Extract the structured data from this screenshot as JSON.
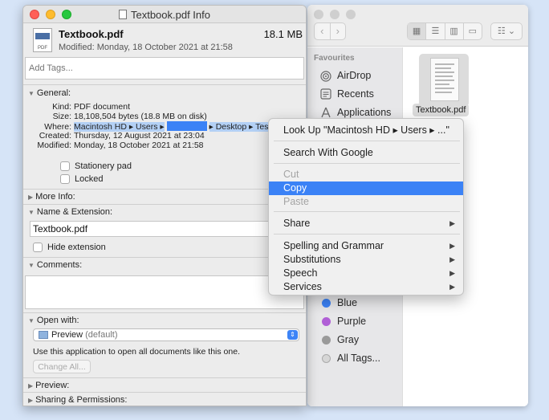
{
  "finder": {
    "nav_back": "‹",
    "nav_forward": "›",
    "view_modes": [
      "▦",
      "☰",
      "▥",
      "▭"
    ],
    "group_label": "☷ ⌄",
    "sidebar_header": "Favourites",
    "sidebar_items": [
      {
        "label": "AirDrop",
        "icon": "airdrop-icon"
      },
      {
        "label": "Recents",
        "icon": "clock-icon"
      },
      {
        "label": "Applications",
        "icon": "applications-icon"
      }
    ],
    "tags": [
      {
        "label": "Blue",
        "color": "#3b82f6"
      },
      {
        "label": "Purple",
        "color": "#b05fd6"
      },
      {
        "label": "Gray",
        "color": "#9a9a9a"
      },
      {
        "label": "All Tags...",
        "color": "#d6d6d6"
      }
    ],
    "file_label": "Textbook.pdf"
  },
  "info": {
    "window_title": "Textbook.pdf Info",
    "icon_label": "PDF",
    "file_name": "Textbook.pdf",
    "file_size": "18.1 MB",
    "modified_line": "Modified: Monday, 18 October 2021 at 21:58",
    "tags_placeholder": "Add Tags...",
    "general": {
      "header": "General:",
      "kind_label": "Kind:",
      "kind": "PDF document",
      "size_label": "Size:",
      "size": "18,108,504 bytes (18.8 MB on disk)",
      "where_label": "Where:",
      "where_start": "Macintosh HD ▸ Users ▸",
      "where_end": "▸ Desktop ▸ Test",
      "created_label": "Created:",
      "created": "Thursday, 12 August 2021 at 23:04",
      "modified_label": "Modified:",
      "modified": "Monday, 18 October 2021 at 21:58",
      "stationery": "Stationery pad",
      "locked": "Locked"
    },
    "more_info": "More Info:",
    "name_extension": {
      "header": "Name & Extension:",
      "value": "Textbook.pdf",
      "hide_extension": "Hide extension"
    },
    "comments_header": "Comments:",
    "open_with": {
      "header": "Open with:",
      "app": "Preview",
      "default_tag": "(default)",
      "use_app_text": "Use this application to open all documents like this one.",
      "change_all": "Change All..."
    },
    "preview": "Preview:",
    "sharing": "Sharing & Permissions:"
  },
  "context_menu": {
    "look_up": "Look Up \"Macintosh HD ▸ Users ▸ ...\"",
    "search_google": "Search With Google",
    "cut": "Cut",
    "copy": "Copy",
    "paste": "Paste",
    "share": "Share",
    "spelling": "Spelling and Grammar",
    "substitutions": "Substitutions",
    "speech": "Speech",
    "services": "Services",
    "submenu_arrow": "▶"
  }
}
